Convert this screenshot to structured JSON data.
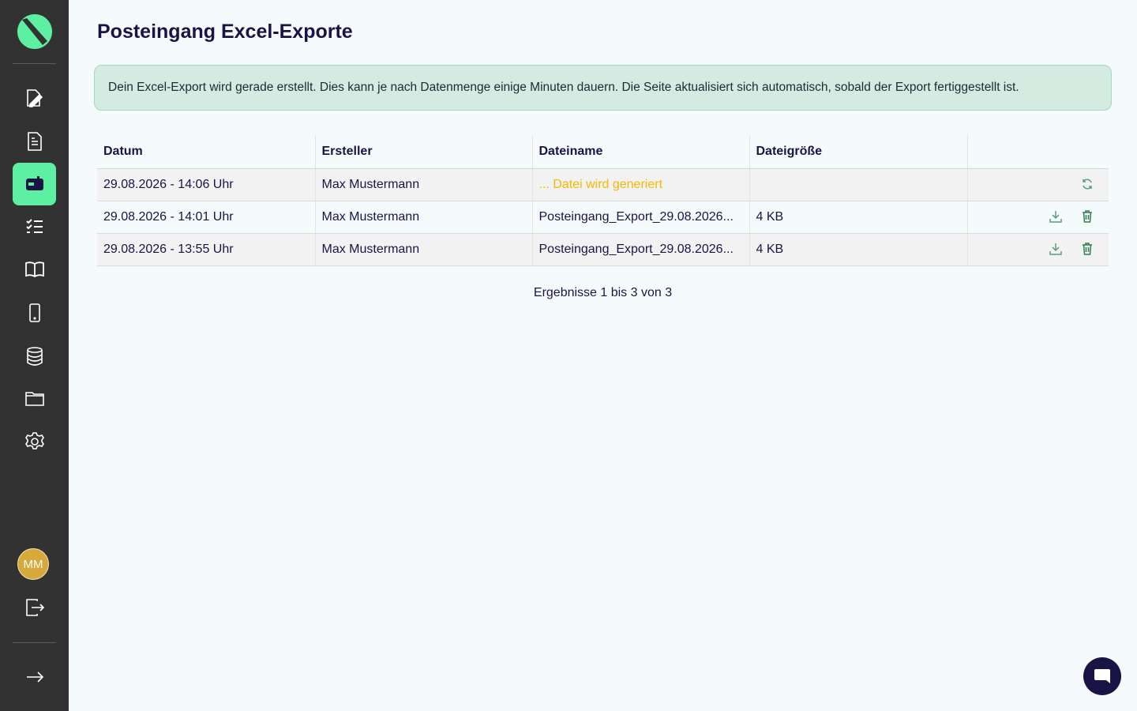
{
  "page": {
    "title": "Posteingang Excel-Exporte"
  },
  "alert": {
    "text": "Dein Excel-Export wird gerade erstellt. Dies kann je nach Datenmenge einige Minuten dauern. Die Seite aktualisiert sich automatisch, sobald der Export fertiggestellt ist."
  },
  "sidebar": {
    "items": [
      {
        "icon": "edit-document-icon",
        "active": false
      },
      {
        "icon": "document-icon",
        "active": false
      },
      {
        "icon": "inbox-icon",
        "active": true
      },
      {
        "icon": "checklist-icon",
        "active": false
      },
      {
        "icon": "book-icon",
        "active": false
      },
      {
        "icon": "smartphone-icon",
        "active": false
      },
      {
        "icon": "database-icon",
        "active": false
      },
      {
        "icon": "folder-icon",
        "active": false
      },
      {
        "icon": "gear-icon",
        "active": false
      }
    ],
    "user_initials": "MM"
  },
  "table": {
    "headers": [
      "Datum",
      "Ersteller",
      "Dateiname",
      "Dateigröße",
      ""
    ],
    "rows": [
      {
        "date": "29.08.2026 - 14:06 Uhr",
        "user": "Max Mustermann",
        "file": "... Datei wird generiert",
        "size": "",
        "status": "generating"
      },
      {
        "date": "29.08.2026 - 14:01 Uhr",
        "user": "Max Mustermann",
        "file": "Posteingang_Export_29.08.2026...",
        "size": "4 KB",
        "status": "done"
      },
      {
        "date": "29.08.2026 - 13:55 Uhr",
        "user": "Max Mustermann",
        "file": "Posteingang_Export_29.08.2026...",
        "size": "4 KB",
        "status": "done"
      }
    ]
  },
  "pagination": {
    "text": "Ergebnisse 1 bis 3 von 3"
  },
  "colors": {
    "accent": "#5ef0a2",
    "sidebar": "#323232",
    "generating": "#f5b800",
    "title": "#1a1446"
  }
}
